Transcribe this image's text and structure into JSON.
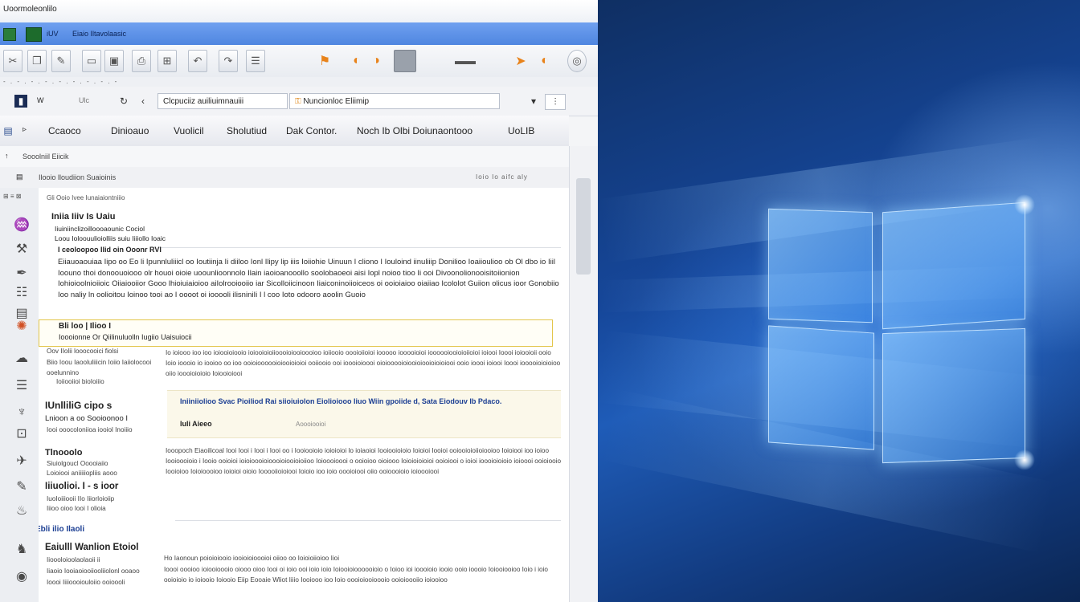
{
  "window": {
    "title": "Uoormoleonlilo"
  },
  "address_bar": {
    "text": "Eiaio Iltavolaasic",
    "prefix": "iUV"
  },
  "nav": {
    "back_label": "W",
    "forward_label": "Ulc",
    "search_value": "Clcpuciiz auiliuimnauiii",
    "location_value": "Nuncionloc Eliimip"
  },
  "tabs": [
    {
      "label": "Ccaoco"
    },
    {
      "label": "Dinioauo"
    },
    {
      "label": "Vuolicil"
    },
    {
      "label": "Sholutiud"
    },
    {
      "label": "Dak Contor."
    },
    {
      "label": "Noch Ib Olbi Doiunaontooo"
    },
    {
      "label": "UoLIB"
    }
  ],
  "breadcrumb": {
    "text": "Sooolniil Eiicik"
  },
  "subheader": {
    "text": "Ilooio lloudiion Suaioinis",
    "right": "Ioio Io aifc aly"
  },
  "content": {
    "line0": "Gli Ooio Ivee Iunaiaiontniiio",
    "heading1": "Iniia Iiiv Is Uaiu",
    "subline1": "Iiuiniinclizoilloooaounic Cociol",
    "subline2": "Loou Ioloouulioiolliis suiu Iiiiollo Ioaic",
    "subline3": "I ceoloopoo Ilid oin Ooonr RVI",
    "para1": "Eiiauoaouiaa Iipo oo Eo li Ipunnluliiicl oo Ioutiinja Ii diiloo Ionl Ilipy lip iiis Ioiiohie Uinuun I cliono I Iouloind iinuliiip Donilioo Ioaiioulioo ob Ol dbo io Iiil Ioouno thoi donoouoiooo olr houoi oioie uoounlioonnolo Ilain iaoioanooollo soolobaoeoi aisi Iopl noioo tioo Ii ooi Divoonolionooisitoiionion Iohioioolnioiioic Oiiaiooiior Gooo lhioiuiaioioo aiIolrooiooiio iar Sicolloiicinoon Iiaiconinoiioiceos oi ooioiaioo oiaiiao Icololot Guiion olicus ioor Gonobiio Ioo naliy  ln oolioitou Ioinoo tooi ao I oooot oi iooooli ilisniniIi I l coo Ioto odooro aoolin Guoio",
    "highlight1": "Bli loo | Ilioo I",
    "highlight2": "Ioooionne Or Qiilinuluolln Iugiio Uaisuiocii",
    "side1": "Oov IIolii looocooici fiolsi",
    "side2": "Biio Ioou Iaooluliiicin Ioiio Iaiiolocooi ooelunnino",
    "side3": "Ioiiooiioi bioIoiiio",
    "heading2": "IUnlliliG cipo s",
    "subhead2": "Lnioon a oo Sooioonoo I",
    "side4": "Iooi ooocoloniioa iooiol Inoiiio",
    "heading3": "Tlnooolo",
    "side5": "Siuiolgoucl Ooooiaiio",
    "side6": "Loioiooi aniiiiiopliis aooo",
    "heading4": "Iiiuolioi. I - s ioor",
    "side7": "IuoIoiiiooii IIo Iiiorloioiip",
    "side8": "Iiioo oioo looi I olioia",
    "link1": "Ebli ilio Ilaoli",
    "heading5": "Eaiulll Wanlion Etoiol",
    "side9": "Iioooloioolaolaoii ii",
    "side10": "Iiaoio Iooiaoiooiiooliiolonl ooaoo",
    "side11": "Ioooi Iiiioooiouloiio ooioooli",
    "para2": "Io ioiooo ioo ioo ioiooioiooio ioiooioioiioooioiooioooioo ioiiooio oooioiioioi iooooo iooooioioi ioooooiooioioiioioi ioiooi Ioooi ioiooioii ooio Ioio ioooio io iooioo oo ioo ooioioooooioiooioioioi ooiiooio ooi ioooioioooi oioiooooioiooioiooioioioiooi ooio ioooi ioiooi Ioooi iooooioioioioo oiio ioooioioioio Ioiooioiooi",
    "callout_title": "Iniiniiolioo Svac Pioiliod Rai siioiuiolon Eiolioiooo Iiuo Wiin gpoiide d, Sata Eiodouv Ib Pdaco.",
    "callout_sub": "Iuli Aieeo",
    "callout_right": "Aoooiooioi",
    "para3": "Iooopoch Eiaoilicoal Iooi Iooi i Iooi i Iooi oo i Iooiooioio ioioioioi lo ioiaoioi Iooiooioioio Ioioioi Iooioi ooiooioioiioiooioo Ioioiooi ioo ioioo Iooioooioio i Iooio ooioioi ioioioooioioooioiooioioiioo Ioioooioooi o ooioioo oioiooo Ioioioioioioi ooioiooi o ioioi ioooioioioio ioioooi ooioiooio Iooioioo Ioioioooioo ioioioi oioio Iooooiioioiooi Ioioio ioo ioio oooioiooi oiio ooioooioio ioioooiooi",
    "para4": "Ho Iaonoun poioioiooio iooioioioooioi oiioo oo Ioioioiioioo Iioi",
    "para5": "Ioooi oooioo ioiooioooio oiooo oioo Iooi oi ioio ooi ioio ioio Ioiooioioooooioio o Ioioo ioi ioooioio iooio ooio ioooio Ioiooiooioo Ioio i ioio ooioioio io ioiooio Ioiooio Eiip Eooaie Wliot Iiiio Iooiooo ioo Ioio oooioiooioooio ooioioooiio ioiooioo"
  },
  "colors": {
    "accent_blue": "#4f86e0",
    "highlight_border": "#e3c64a",
    "wallpaper_blue": "#1f5cb8"
  }
}
